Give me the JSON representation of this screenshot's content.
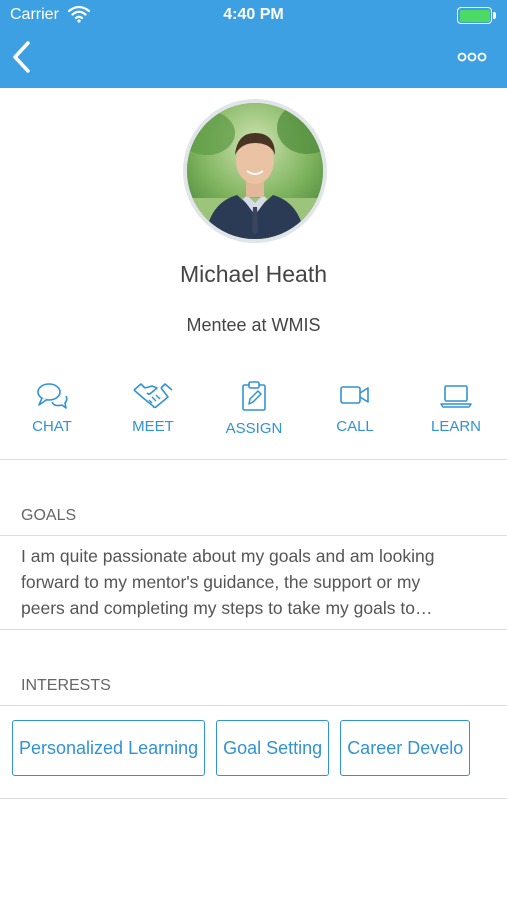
{
  "status_bar": {
    "carrier": "Carrier",
    "time": "4:40 PM",
    "battery_color": "#4cd964"
  },
  "nav": {
    "back_icon": "chevron-left-icon",
    "more_icon": "more-dots-icon",
    "bar_color": "#3da0e3"
  },
  "profile": {
    "name": "Michael Heath",
    "role": "Mentee at WMIS"
  },
  "actions": [
    {
      "label": "CHAT",
      "icon": "chat-bubbles-icon"
    },
    {
      "label": "MEET",
      "icon": "handshake-icon"
    },
    {
      "label": "ASSIGN",
      "icon": "clipboard-pencil-icon"
    },
    {
      "label": "CALL",
      "icon": "video-camera-icon"
    },
    {
      "label": "LEARN",
      "icon": "laptop-icon"
    }
  ],
  "goals": {
    "title": "GOALS",
    "lines": [
      "I am quite passionate about my goals and am looking",
      "forward to my mentor's guidance, the support or my",
      "peers and completing my steps to take my goals to…"
    ]
  },
  "interests": {
    "title": "INTERESTS",
    "chips": [
      "Personalized Learning",
      "Goal Setting",
      "Career Develo"
    ]
  },
  "accent_color": "#3192d4"
}
